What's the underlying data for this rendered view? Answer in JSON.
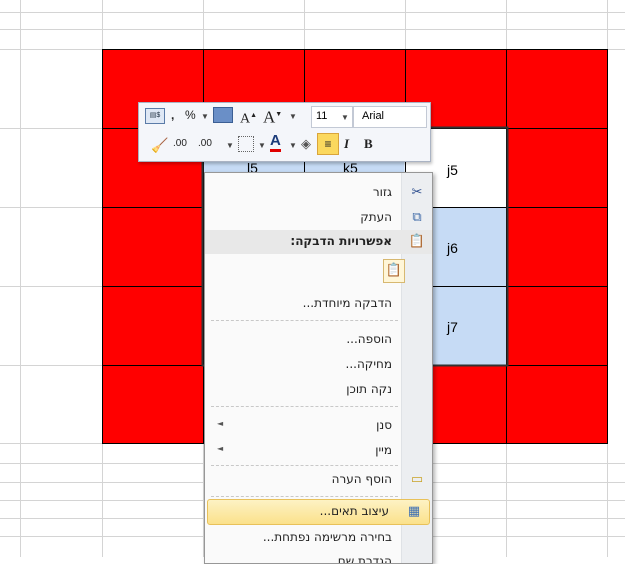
{
  "cells": {
    "l5": "l5",
    "k5": "k5",
    "j5": "j5",
    "j6": "j6",
    "j7": "j7"
  },
  "mini_toolbar": {
    "comma": ",",
    "percent": "%",
    "font_size": "11",
    "font_name": "Arial",
    "italic": "I",
    "bold": "B",
    "increase_decimal": ".00",
    "decrease_decimal": ".00"
  },
  "context_menu": {
    "cut": "גזור",
    "copy": "העתק",
    "paste_options": "אפשרויות הדבקה:",
    "paste_special": "הדבקה מיוחדת...",
    "insert": "הוספה...",
    "delete": "מחיקה...",
    "clear_contents": "נקה תוכן",
    "filter": "סנן",
    "sort": "מיין",
    "insert_comment": "הוסף הערה",
    "format_cells": "עיצוב תאים...",
    "pick_from_list": "בחירה מרשימה נפתחת...",
    "define_name": "הגדרת שם..."
  },
  "colors": {
    "red_fill": "#ff0000",
    "selection_fill": "#c6dbf5",
    "grid": "#d4d4d4"
  }
}
